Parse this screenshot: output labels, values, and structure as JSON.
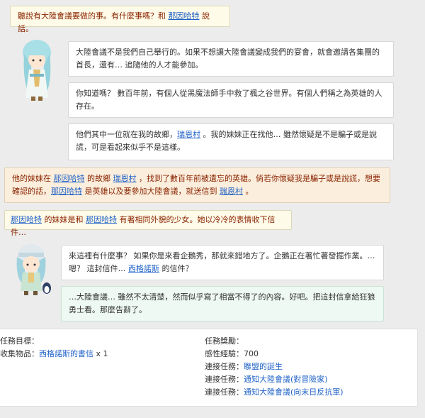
{
  "dialogs": {
    "intro": {
      "pre": "聽說有大陸會議要做的事。有什麼事嗎？和 ",
      "link": "那因哈特",
      "post": " 說話。"
    },
    "npc1_line1": {
      "text": "大陸會議不是我們自己舉行的。如果不想讓大陸會議變成我們的宴會，就會邀請各集團的首長，還有… 追隨他的人才能參加。"
    },
    "npc1_line2": {
      "text": "你知道嗎？ 數百年前，有個人從黑魔法師手中救了楓之谷世界。有個人們稱之為英雄的人存在。"
    },
    "npc1_line3": {
      "pre": "他們其中一位就在我的故鄉，",
      "link": "瑞恩村",
      "post": " 。我的妹妹正在找他… 雖然懷疑是不是騙子或是說謊，可是看起來似乎不是這樣。"
    },
    "summary1": {
      "p1": "他的妹妹在 ",
      "link1": "那因哈特",
      "p2": " 的故鄉 ",
      "link2": "瑞恩村",
      "p3": " ，找到了數百年前被遺忘的英雄。倘若你懷疑我是騙子或是說謊，想要確認的話，",
      "link3": "那因哈特",
      "p4": " 是英雄以及要參加大陸會議，就送信到 ",
      "link4": "瑞恩村",
      "p5": " 。"
    },
    "summary2": {
      "link1": "那因哈特",
      "p1": " 的妹妹是和 ",
      "link2": "那因哈特",
      "p2": " 有著相同外貌的少女。她以冷冷的表情收下信件…"
    },
    "npc2_line1": {
      "pre": "來這裡有什麼事？ 如果你是來看企鵝秀，那就來錯地方了。企鵝正在著忙著發掘作業。… 嗯？ 這封信件… ",
      "link": "西格諾斯",
      "post": " 的信件？"
    },
    "npc2_line2": {
      "text": "…大陸會議… 雖然不太清楚，然而似乎寫了相當不得了的內容。好吧。把這封信拿給狂狼勇士看。那麼告辭了。"
    }
  },
  "quest": {
    "objective_title": "任務目標：",
    "collect_label": "收集物品：",
    "collect_item": "西格諾斯的書信",
    "collect_qty": "x 1",
    "reward_title": "任務獎勵：",
    "exp_label": "感性經驗：",
    "exp_value": "700",
    "links": [
      {
        "label": "連接任務：",
        "value": "聯盟的誕生"
      },
      {
        "label": "連接任務：",
        "value": "通知大陸會議(對冒險家)"
      },
      {
        "label": "連接任務：",
        "value": "通知大陸會議(向末日反抗軍)"
      }
    ]
  },
  "colors": {
    "link": "#1f62c7",
    "dark_text": "#8a2400",
    "ivory": "#fffbe9",
    "peach": "#fbeedd",
    "mint": "#eef9f3"
  }
}
